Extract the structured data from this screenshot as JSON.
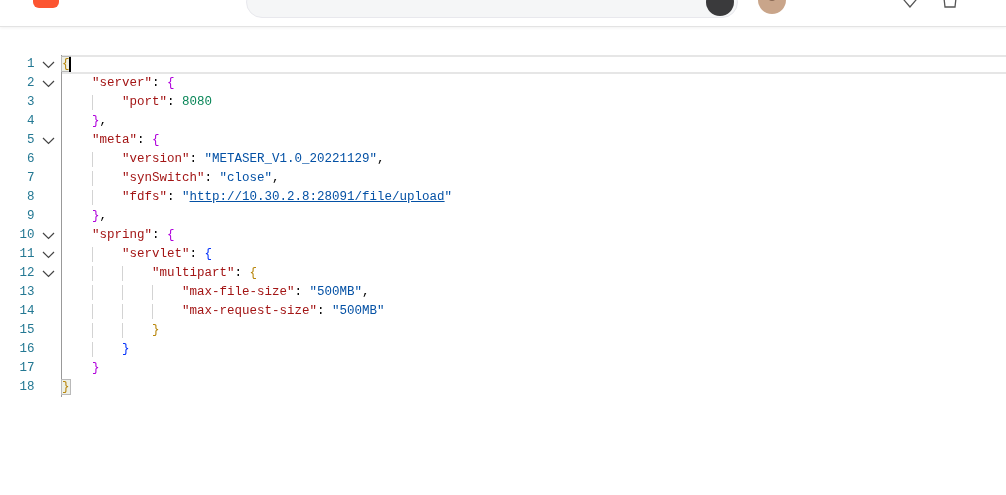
{
  "editor": {
    "lines": [
      {
        "number": "1",
        "foldable": true,
        "expanded": true,
        "current": true,
        "tokens": [
          {
            "kind": "brace",
            "text": "{",
            "matched": true
          }
        ],
        "children": [
          {
            "number": "2",
            "foldable": true,
            "expanded": true,
            "current": false,
            "tokens": [
              {
                "kind": "key",
                "text": "\"server\""
              },
              {
                "kind": "punct",
                "text": ": "
              },
              {
                "kind": "brace",
                "text": "{"
              }
            ],
            "children": [
              {
                "number": "3",
                "foldable": false,
                "current": false,
                "tokens": [
                  {
                    "kind": "key",
                    "text": "\"port\""
                  },
                  {
                    "kind": "punct",
                    "text": ": "
                  },
                  {
                    "kind": "number",
                    "text": "8080"
                  }
                ]
              }
            ]
          },
          {
            "number": "4",
            "foldable": false,
            "current": false,
            "tokens": [
              {
                "kind": "brace",
                "text": "}"
              },
              {
                "kind": "punct",
                "text": ","
              }
            ]
          },
          {
            "number": "5",
            "foldable": true,
            "expanded": true,
            "current": false,
            "tokens": [
              {
                "kind": "key",
                "text": "\"meta\""
              },
              {
                "kind": "punct",
                "text": ": "
              },
              {
                "kind": "brace",
                "text": "{"
              }
            ],
            "children": [
              {
                "number": "6",
                "foldable": false,
                "current": false,
                "tokens": [
                  {
                    "kind": "key",
                    "text": "\"version\""
                  },
                  {
                    "kind": "punct",
                    "text": ": "
                  },
                  {
                    "kind": "string",
                    "text": "\"METASER_V1.0_20221129\""
                  },
                  {
                    "kind": "punct",
                    "text": ","
                  }
                ]
              },
              {
                "number": "7",
                "foldable": false,
                "current": false,
                "tokens": [
                  {
                    "kind": "key",
                    "text": "\"synSwitch\""
                  },
                  {
                    "kind": "punct",
                    "text": ": "
                  },
                  {
                    "kind": "string",
                    "text": "\"close\""
                  },
                  {
                    "kind": "punct",
                    "text": ","
                  }
                ]
              },
              {
                "number": "8",
                "foldable": false,
                "current": false,
                "tokens": [
                  {
                    "kind": "key",
                    "text": "\"fdfs\""
                  },
                  {
                    "kind": "punct",
                    "text": ": "
                  },
                  {
                    "kind": "string",
                    "text": "\""
                  },
                  {
                    "kind": "link",
                    "text": "http://10.30.2.8:28091/file/upload"
                  },
                  {
                    "kind": "string",
                    "text": "\""
                  }
                ]
              }
            ]
          },
          {
            "number": "9",
            "foldable": false,
            "current": false,
            "tokens": [
              {
                "kind": "brace",
                "text": "}"
              },
              {
                "kind": "punct",
                "text": ","
              }
            ]
          },
          {
            "number": "10",
            "foldable": true,
            "expanded": true,
            "current": false,
            "tokens": [
              {
                "kind": "key",
                "text": "\"spring\""
              },
              {
                "kind": "punct",
                "text": ": "
              },
              {
                "kind": "brace",
                "text": "{"
              }
            ],
            "children": [
              {
                "number": "11",
                "foldable": true,
                "expanded": true,
                "current": false,
                "tokens": [
                  {
                    "kind": "key",
                    "text": "\"servlet\""
                  },
                  {
                    "kind": "punct",
                    "text": ": "
                  },
                  {
                    "kind": "brace",
                    "text": "{"
                  }
                ],
                "children": [
                  {
                    "number": "12",
                    "foldable": true,
                    "expanded": true,
                    "current": false,
                    "tokens": [
                      {
                        "kind": "key",
                        "text": "\"multipart\""
                      },
                      {
                        "kind": "punct",
                        "text": ": "
                      },
                      {
                        "kind": "brace",
                        "text": "{"
                      }
                    ],
                    "children": [
                      {
                        "number": "13",
                        "foldable": false,
                        "current": false,
                        "tokens": [
                          {
                            "kind": "key",
                            "text": "\"max-file-size\""
                          },
                          {
                            "kind": "punct",
                            "text": ": "
                          },
                          {
                            "kind": "string",
                            "text": "\"500MB\""
                          },
                          {
                            "kind": "punct",
                            "text": ","
                          }
                        ]
                      },
                      {
                        "number": "14",
                        "foldable": false,
                        "current": false,
                        "tokens": [
                          {
                            "kind": "key",
                            "text": "\"max-request-size\""
                          },
                          {
                            "kind": "punct",
                            "text": ": "
                          },
                          {
                            "kind": "string",
                            "text": "\"500MB\""
                          }
                        ]
                      }
                    ]
                  },
                  {
                    "number": "15",
                    "foldable": false,
                    "current": false,
                    "tokens": [
                      {
                        "kind": "brace",
                        "text": "}"
                      }
                    ]
                  }
                ]
              },
              {
                "number": "16",
                "foldable": false,
                "current": false,
                "tokens": [
                  {
                    "kind": "brace",
                    "text": "}"
                  }
                ]
              }
            ]
          },
          {
            "number": "17",
            "foldable": false,
            "current": false,
            "tokens": [
              {
                "kind": "brace",
                "text": "}"
              }
            ]
          }
        ]
      },
      {
        "number": "18",
        "foldable": false,
        "current": false,
        "tokens": [
          {
            "kind": "brace",
            "text": "}",
            "matched": true
          }
        ]
      }
    ]
  }
}
